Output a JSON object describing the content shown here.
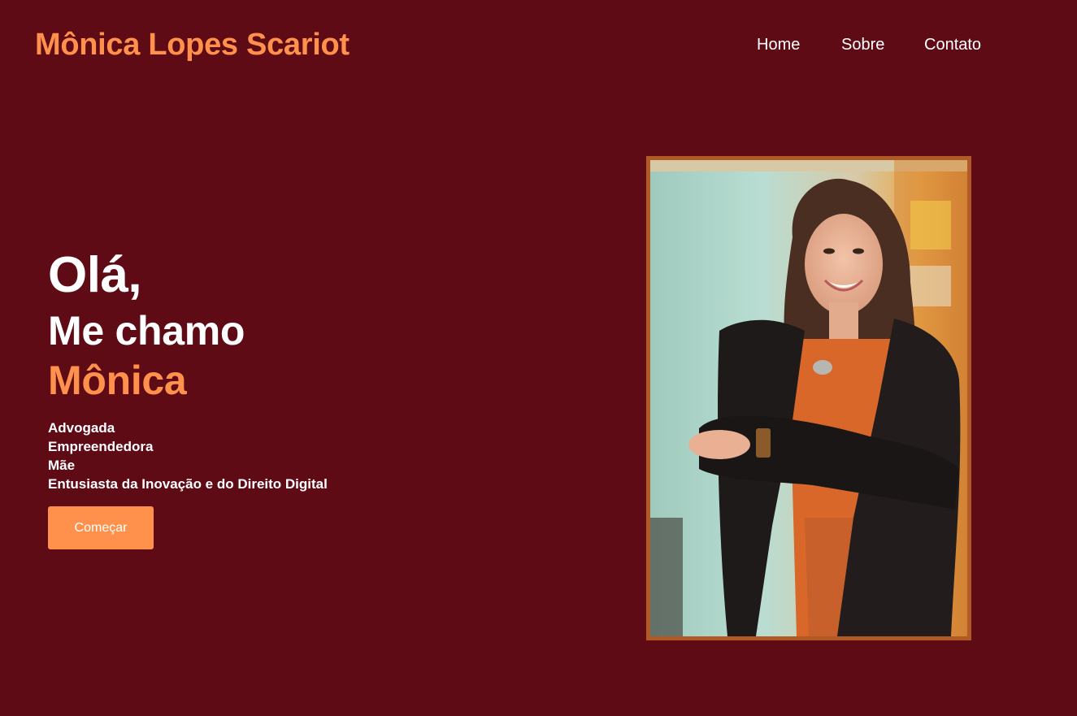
{
  "header": {
    "brand": "Mônica Lopes Scariot",
    "nav": [
      {
        "label": "Home"
      },
      {
        "label": "Sobre"
      },
      {
        "label": "Contato"
      }
    ]
  },
  "hero": {
    "greeting": "Olá,",
    "intro": "Me chamo",
    "name": "Mônica",
    "roles": [
      "Advogada",
      "Empreendedora",
      "Mãe",
      "Entusiasta da Inovação e do Direito Digital"
    ],
    "cta_label": "Começar"
  },
  "colors": {
    "background": "#5e0b16",
    "accent": "#ff914d",
    "frame": "#b25a25",
    "text": "#ffffff"
  }
}
